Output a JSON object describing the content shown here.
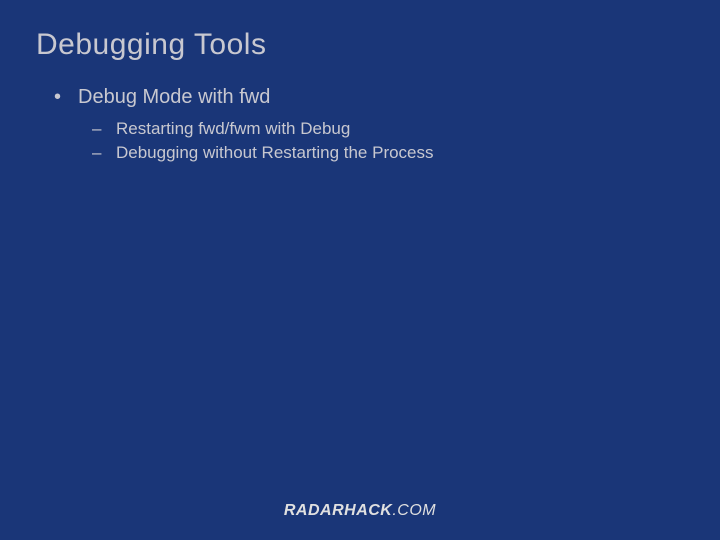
{
  "slide": {
    "title": "Debugging Tools",
    "bullets": {
      "level1": "Debug Mode with fwd",
      "level2_a": "Restarting fwd/fwm with Debug",
      "level2_b": "Debugging without Restarting the Process"
    }
  },
  "footer": {
    "brand_bold": "RADARHACK",
    "brand_thin": ".COM"
  }
}
